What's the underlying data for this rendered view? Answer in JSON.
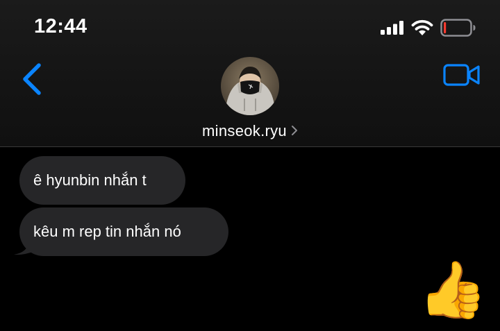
{
  "status_bar": {
    "time": "12:44"
  },
  "header": {
    "contact_name": "minseok.ryu"
  },
  "messages": [
    {
      "sender": "contact",
      "text": "ê hyunbin nhắn t"
    },
    {
      "sender": "contact",
      "text": "kêu m rep tin nhắn nó"
    },
    {
      "sender": "me",
      "text": "👍"
    }
  ],
  "colors": {
    "accent": "#0a84ff",
    "incoming_bubble": "#262628",
    "background": "#000000",
    "battery_low": "#ff3b30"
  }
}
